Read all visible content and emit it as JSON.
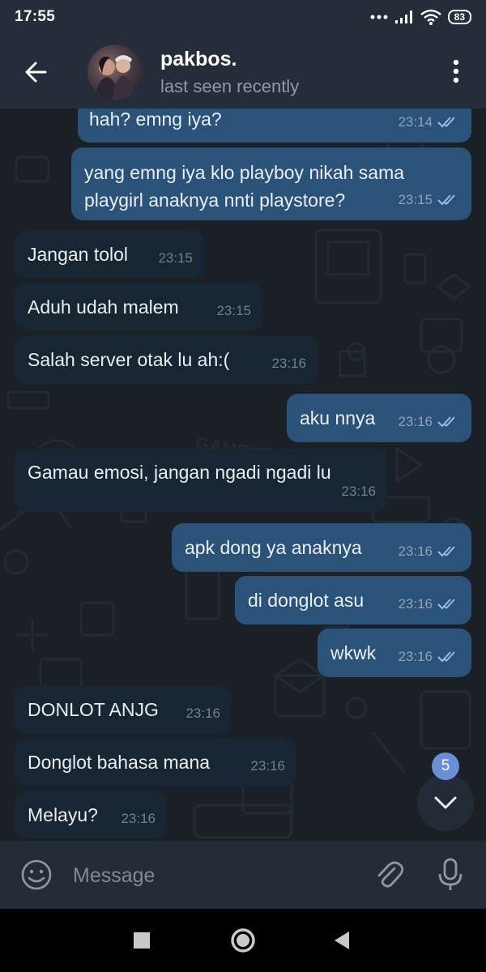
{
  "status_bar": {
    "time": "17:55",
    "battery": "83"
  },
  "header": {
    "name": "pakbos.",
    "status": "last seen recently"
  },
  "messages": [
    {
      "text": "hah? emng iya?",
      "time": "23:14",
      "dir": "out"
    },
    {
      "text": "yang emng iya klo playboy nikah sama playgirl anaknya nnti playstore?",
      "time": "23:15",
      "dir": "out"
    },
    {
      "text": "Jangan tolol",
      "time": "23:15",
      "dir": "in"
    },
    {
      "text": "Aduh udah malem",
      "time": "23:15",
      "dir": "in"
    },
    {
      "text": "Salah server otak lu ah:(",
      "time": "23:16",
      "dir": "in"
    },
    {
      "text": "aku nnya",
      "time": "23:16",
      "dir": "out"
    },
    {
      "text": "Gamau emosi, jangan ngadi ngadi lu",
      "time": "23:16",
      "dir": "in"
    },
    {
      "text": "apk dong ya anaknya",
      "time": "23:16",
      "dir": "out"
    },
    {
      "text": "di donglot asu",
      "time": "23:16",
      "dir": "out"
    },
    {
      "text": "wkwk",
      "time": "23:16",
      "dir": "out"
    },
    {
      "text": "DONLOT ANJG",
      "time": "23:16",
      "dir": "in"
    },
    {
      "text": "Donglot bahasa mana",
      "time": "23:16",
      "dir": "in"
    },
    {
      "text": "Melayu?",
      "time": "23:16",
      "dir": "in"
    }
  ],
  "unread_badge": "5",
  "input": {
    "placeholder": "Message",
    "value": ""
  },
  "colors": {
    "outgoing_bubble": "#2b5278",
    "incoming_bubble": "#182533",
    "header_bg": "#242d39",
    "chat_bg": "#1b2027",
    "badge": "#6a8fd6"
  },
  "icons": [
    "back-arrow-icon",
    "more-vert-icon",
    "double-check-icon",
    "chevron-down-icon",
    "emoji-icon",
    "paperclip-icon",
    "mic-icon",
    "nav-recents-icon",
    "nav-home-icon",
    "nav-back-icon",
    "wifi-icon",
    "signal-icon"
  ]
}
